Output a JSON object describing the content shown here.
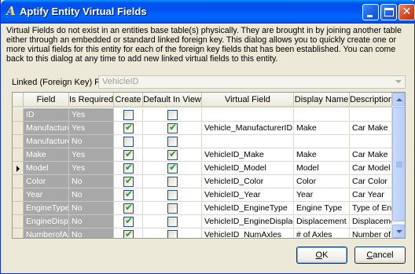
{
  "window": {
    "title": "Aptify Entity Virtual Fields",
    "icon": "aptify-logo-icon"
  },
  "description": "Virtual Fields do not exist in an entities base table(s) physically.  They are brought in by joining another table either through an embedded or standard linked foreign key. This dialog allows you to quickly create one or more virtual fields for this entity for each of the foreign key fields that has been established. You can come back to this dialog at any time to add new linked virtual fields to this entity.",
  "linked_key": {
    "label": "Linked (Foreign Key) Field",
    "value": "VehicleID"
  },
  "grid": {
    "columns": [
      "Field",
      "Is Required",
      "Create",
      "Default In View",
      "Virtual Field",
      "Display Name",
      "Description"
    ],
    "rows": [
      {
        "field": "ID",
        "required": "Yes",
        "create": false,
        "default_in_view": false,
        "virtual_field": "",
        "display_name": "",
        "description": "",
        "current": false
      },
      {
        "field": "Manufacture",
        "required": "Yes",
        "create": true,
        "default_in_view": true,
        "virtual_field": "Vehicle_ManufacturerID",
        "display_name": "Make",
        "description": "Car Make",
        "current": false
      },
      {
        "field": "Manufacture",
        "required": "No",
        "create": false,
        "default_in_view": false,
        "virtual_field": "",
        "display_name": "",
        "description": "",
        "current": false
      },
      {
        "field": "Make",
        "required": "Yes",
        "create": true,
        "default_in_view": true,
        "virtual_field": "VehicleID_Make",
        "display_name": "Make",
        "description": "Car Make",
        "current": false
      },
      {
        "field": "Model",
        "required": "Yes",
        "create": true,
        "default_in_view": true,
        "virtual_field": "VehicleID_Model",
        "display_name": "Model",
        "description": "Car Model",
        "current": true
      },
      {
        "field": "Color",
        "required": "No",
        "create": true,
        "default_in_view": false,
        "virtual_field": "VehicleID_Color",
        "display_name": "Color",
        "description": "Car Color",
        "current": false
      },
      {
        "field": "Year",
        "required": "No",
        "create": true,
        "default_in_view": false,
        "virtual_field": "VehicleID_Year",
        "display_name": "Year",
        "description": "Car Year",
        "current": false
      },
      {
        "field": "EngineType",
        "required": "No",
        "create": true,
        "default_in_view": false,
        "virtual_field": "VehicleID_EngineType",
        "display_name": "Engine Type",
        "description": "Type of En",
        "current": false
      },
      {
        "field": "EngineDispl",
        "required": "No",
        "create": true,
        "default_in_view": false,
        "virtual_field": "VehicleID_EngineDisplace",
        "display_name": "Displacement",
        "description": "Displaceme",
        "current": false
      },
      {
        "field": "NumberofAx",
        "required": "No",
        "create": true,
        "default_in_view": false,
        "virtual_field": "VehicleID_NumAxles",
        "display_name": "# of Axles",
        "description": "Number of",
        "current": false
      }
    ]
  },
  "buttons": {
    "ok_label": "OK",
    "cancel_label": "Cancel"
  },
  "colors": {
    "titlebar": "#0054e3",
    "readonly_cell": "#a8a8a8",
    "checkmark": "#21a121"
  }
}
